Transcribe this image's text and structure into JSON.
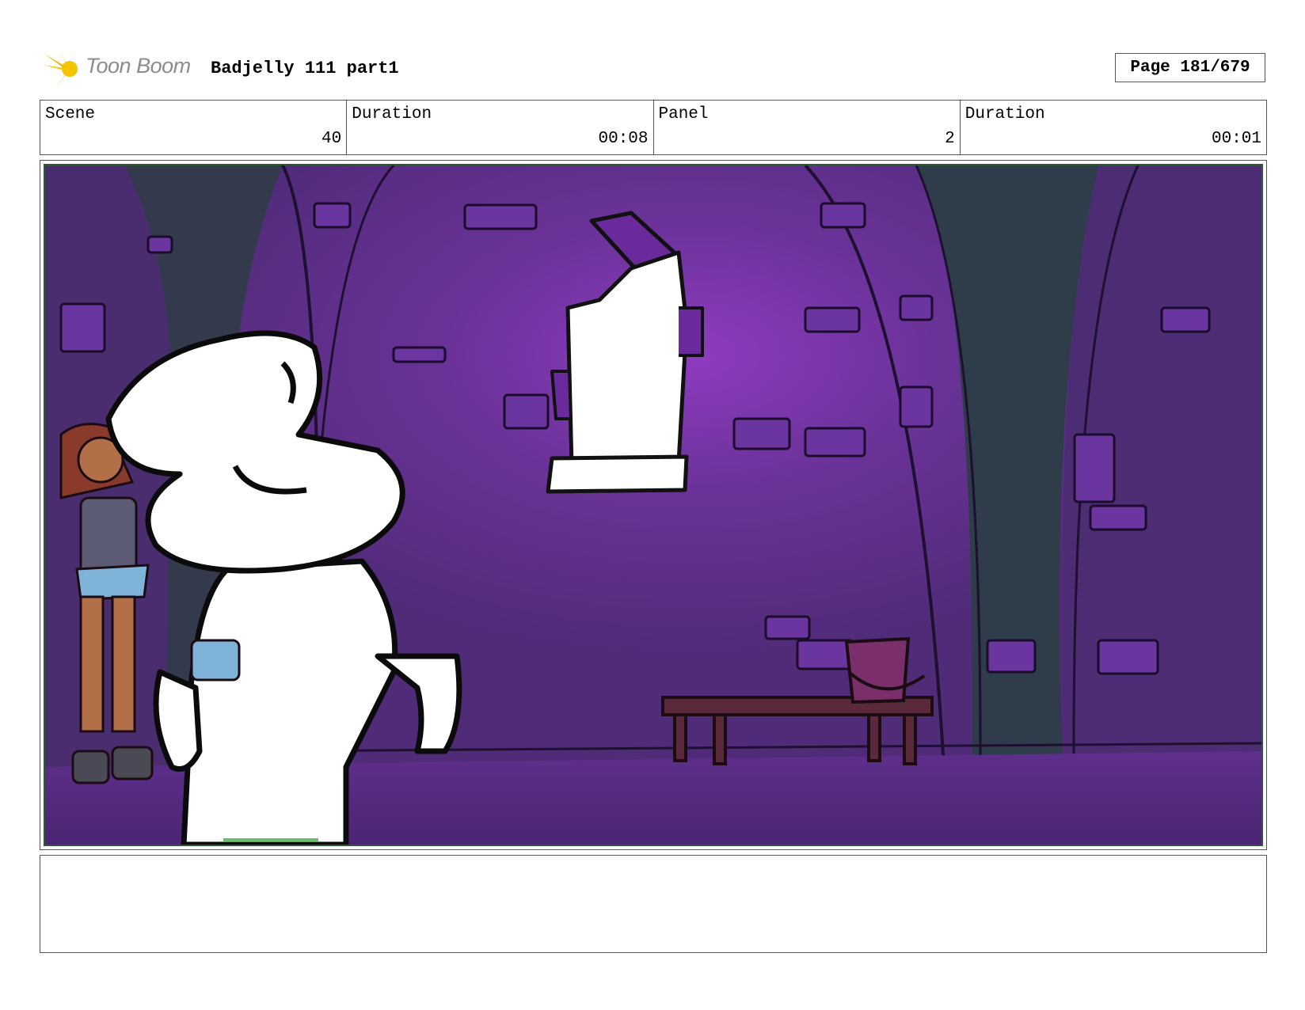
{
  "header": {
    "logo_text": "Toon Boom",
    "project_title": "Badjelly 111 part1",
    "page_label": "Page 181/679"
  },
  "info": {
    "scene_label": "Scene",
    "scene_value": "40",
    "scene_duration_label": "Duration",
    "scene_duration_value": "00:08",
    "panel_label": "Panel",
    "panel_value": "2",
    "panel_duration_label": "Duration",
    "panel_duration_value": "00:01"
  },
  "colors": {
    "wall_purple": "#5b2e86",
    "glow_purple": "#8a38b8",
    "pillar_teal": "#2f3d4a",
    "floor_purple": "#5a2d85",
    "frame_green": "#2c5a33"
  },
  "notes": ""
}
